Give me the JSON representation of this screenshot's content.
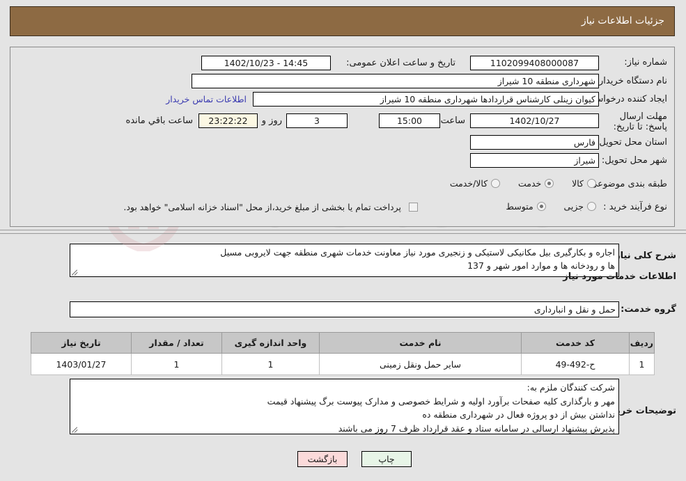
{
  "header": {
    "title": "جزئیات اطلاعات نیاز",
    "bar_color": "#8d6a43"
  },
  "watermark": {
    "text": "AriaTender.net"
  },
  "info": {
    "need_number_label": "شماره نیاز:",
    "need_number_value": "1102099408000087",
    "public_announce_label": "تاریخ و ساعت اعلان عمومی:",
    "public_announce_value": "14:45 - 1402/10/23",
    "buyer_org_label": "نام دستگاه خریدار:",
    "buyer_org_value": "شهرداری منطقه 10 شیراز",
    "creator_label": "ایجاد کننده درخواست:",
    "creator_value": "کیوان زینلی کارشناس قراردادها شهرداری منطقه 10 شیراز",
    "contact_link": "اطلاعات تماس خریدار",
    "deadline_label": "مهلت ارسال پاسخ: تا تاریخ:",
    "deadline_date": "1402/10/27",
    "deadline_hour_label": "ساعت",
    "deadline_hour_value": "15:00",
    "days_value": "3",
    "days_label": "روز و",
    "countdown_value": "23:22:22",
    "countdown_label": "ساعت باقي مانده",
    "province_label": "استان محل تحویل:",
    "province_value": "فارس",
    "city_label": "شهر محل تحویل:",
    "city_value": "شیراز",
    "category_label": "طبقه بندی موضوعی:",
    "category_options": [
      {
        "label": "کالا",
        "selected": false
      },
      {
        "label": "خدمت",
        "selected": true
      },
      {
        "label": "کالا/خدمت",
        "selected": false
      }
    ],
    "process_label": "نوع فرآیند خرید :",
    "process_options": [
      {
        "label": "جزیی",
        "selected": false
      },
      {
        "label": "متوسط",
        "selected": true
      }
    ],
    "treasury_checkbox_checked": false,
    "treasury_note": "پرداخت تمام یا بخشی از مبلغ خرید،از محل \"اسناد خزانه اسلامی\" خواهد بود."
  },
  "description": {
    "label": "شرح کلی نیاز:",
    "line1": "اجاره و بکارگیری بیل مکانیکی لاستیکی و زنجیری مورد نیاز معاونت خدمات شهری منطقه جهت لایروبی مسیل",
    "line2": "ها و رودخانه ها و موارد امور شهر  و 137"
  },
  "services_section": {
    "title": "اطلاعات خدمات مورد نیاز",
    "group_label": "گروه خدمت:",
    "group_value": "حمل و نقل و انبارداری"
  },
  "table": {
    "columns": [
      "ردیف",
      "کد خدمت",
      "نام خدمت",
      "واحد اندازه گیری",
      "تعداد / مقدار",
      "تاریخ نیاز"
    ],
    "rows": [
      {
        "row_no": "1",
        "service_code": "ح-492-49",
        "service_name": "سایر حمل ونقل زمینی",
        "unit": "1",
        "quantity": "1",
        "need_date": "1403/01/27"
      }
    ]
  },
  "buyer_notes": {
    "label": "توضیحات خریدار:",
    "line1": "شرکت کنندگان ملزم به:",
    "line2": "مهر و بارگذاری کلیه صفحات برآورد اولیه و شرایط خصوصی و مدارک پیوست برگ پیشنهاد قیمت",
    "line3": "نداشتن بیش از دو پروژه فعال در شهرداری منطقه ده",
    "line4": "پذیرش پیشنهاد ارسالی در سامانه ستاد و عقد قرارداد ظرف 7 روز می باشند"
  },
  "footer": {
    "print_label": "چاپ",
    "back_label": "بازگشت"
  }
}
